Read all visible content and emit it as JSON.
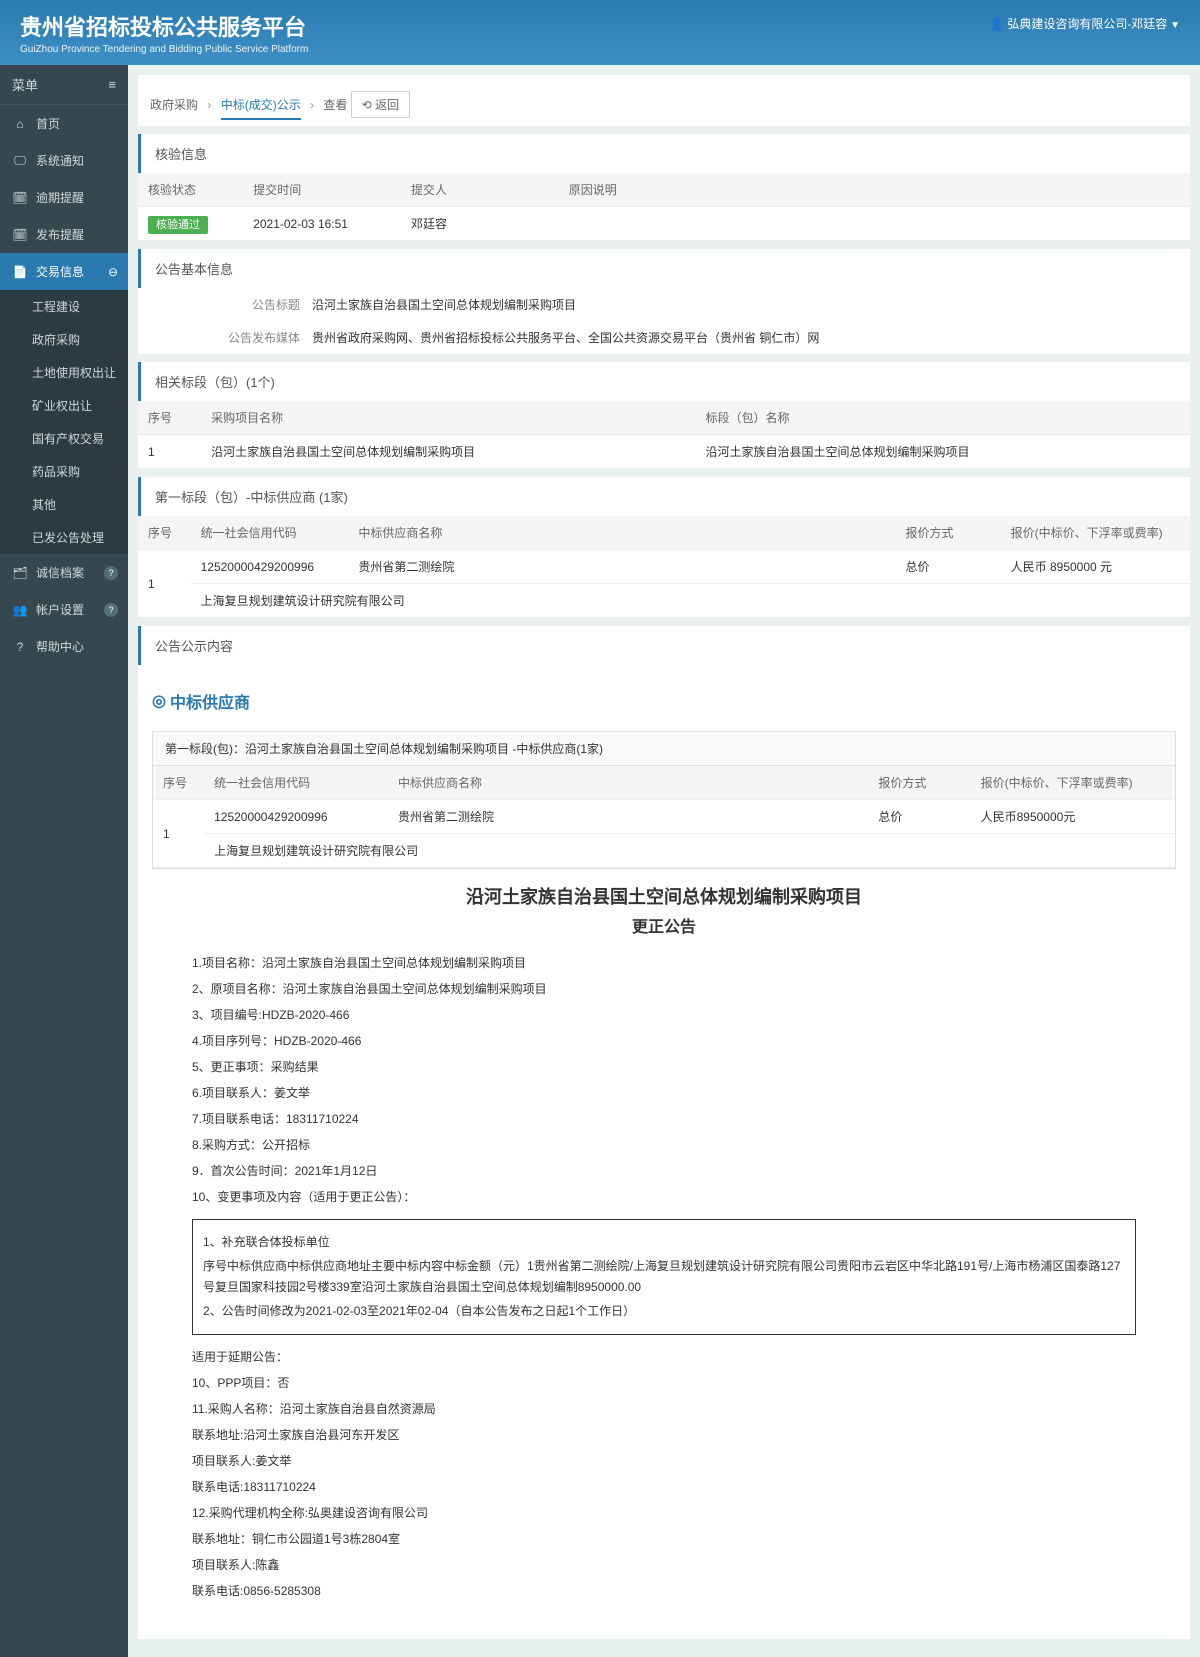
{
  "header": {
    "title": "贵州省招标投标公共服务平台",
    "subtitle": "GuiZhou Province Tendering and Bidding Public Service Platform",
    "user": "弘典建设咨询有限公司-邓廷容"
  },
  "sidebar": {
    "menuLabel": "菜单",
    "items": [
      {
        "icon": "⌂",
        "label": "首页"
      },
      {
        "icon": "🖵",
        "label": "系统通知"
      },
      {
        "icon": "🗓",
        "label": "逾期提醒"
      },
      {
        "icon": "🗓",
        "label": "发布提醒"
      },
      {
        "icon": "📄",
        "label": "交易信息",
        "active": true,
        "expand": true
      }
    ],
    "submenu": [
      "工程建设",
      "政府采购",
      "土地使用权出让",
      "矿业权出让",
      "国有产权交易",
      "药品采购",
      "其他",
      "已发公告处理"
    ],
    "tail": [
      {
        "icon": "🗂",
        "label": "诚信档案",
        "badge": "?"
      },
      {
        "icon": "👥",
        "label": "帐户设置",
        "badge": "?"
      },
      {
        "icon": "?",
        "label": "帮助中心"
      }
    ]
  },
  "breadcrumb": {
    "items": [
      "政府采购",
      "中标(成交)公示",
      "查看"
    ],
    "back": "返回"
  },
  "verify": {
    "title": "核验信息",
    "headers": [
      "核验状态",
      "提交时间",
      "提交人",
      "原因说明"
    ],
    "row": {
      "status": "核验通过",
      "time": "2021-02-03 16:51",
      "person": "邓廷容",
      "reason": ""
    }
  },
  "basic": {
    "title": "公告基本信息",
    "rows": [
      {
        "label": "公告标题",
        "value": "沿河土家族自治县国土空间总体规划编制采购项目"
      },
      {
        "label": "公告发布媒体",
        "value": "贵州省政府采购网、贵州省招标投标公共服务平台、全国公共资源交易平台（贵州省 铜仁市）网"
      }
    ]
  },
  "sections": {
    "related": "相关标段（包）(1个)",
    "winner1": "第一标段（包）-中标供应商 (1家)",
    "content": "公告公示内容"
  },
  "relatedTable": {
    "headers": [
      "序号",
      "采购项目名称",
      "标段（包）名称"
    ],
    "row": {
      "no": "1",
      "name": "沿河土家族自治县国土空间总体规划编制采购项目",
      "section": "沿河土家族自治县国土空间总体规划编制采购项目"
    }
  },
  "winnerTable": {
    "headers": [
      "序号",
      "统一社会信用代码",
      "中标供应商名称",
      "报价方式",
      "报价(中标价、下浮率或费率)"
    ],
    "row1": {
      "no": "1",
      "code": "12520000429200996",
      "name": "贵州省第二测绘院",
      "method": "总价",
      "price": "人民币 8950000 元"
    },
    "row2": {
      "name": "上海复旦规划建筑设计研究院有限公司"
    }
  },
  "winnerSection": {
    "heading": "中标供应商",
    "boxTitle": "第一标段(包)：沿河土家族自治县国土空间总体规划编制采购项目 -中标供应商(1家)",
    "headers": [
      "序号",
      "统一社会信用代码",
      "中标供应商名称",
      "报价方式",
      "报价(中标价、下浮率或费率)"
    ],
    "row1": {
      "no": "1",
      "code": "12520000429200996",
      "name": "贵州省第二测绘院",
      "method": "总价",
      "price": "人民币8950000元"
    },
    "row2": {
      "name": "上海复旦规划建筑设计研究院有限公司"
    }
  },
  "doc": {
    "title": "沿河土家族自治县国土空间总体规划编制采购项目",
    "subtitle": "更正公告",
    "lines": [
      "1.项目名称：沿河土家族自治县国土空间总体规划编制采购项目",
      "2、原项目名称：沿河土家族自治县国土空间总体规划编制采购项目",
      "3、项目编号:HDZB-2020-466",
      "4.项目序列号：HDZB-2020-466",
      "5、更正事项：采购结果",
      "6.项目联系人：姜文举",
      "7.项目联系电话：18311710224",
      "8.采购方式：公开招标",
      "9．首次公告时间：2021年1月12日",
      "10、变更事项及内容（适用于更正公告）："
    ],
    "changeBox": {
      "l1": "1、补充联合体投标单位",
      "l2": "序号中标供应商中标供应商地址主要中标内容中标金额（元）1贵州省第二测绘院/上海复旦规划建筑设计研究院有限公司贵阳市云岩区中华北路191号/上海市杨浦区国泰路127号复旦国家科技园2号楼339室沿河土家族自治县国土空间总体规划编制8950000.00",
      "l3": "2、公告时间修改为2021-02-03至2021年02-04（自本公告发布之日起1个工作日）"
    },
    "lines2": [
      "适用于延期公告：",
      "10、PPP项目：否",
      "11.采购人名称：沿河土家族自治县自然资源局",
      "联系地址:沿河土家族自治县河东开发区",
      "项目联系人:姜文举",
      "联系电话:18311710224",
      "12.采购代理机构全称:弘奥建设咨询有限公司",
      "联系地址：铜仁市公园道1号3栋2804室",
      "项目联系人:陈鑫",
      "联系电话:0856-5285308"
    ]
  }
}
